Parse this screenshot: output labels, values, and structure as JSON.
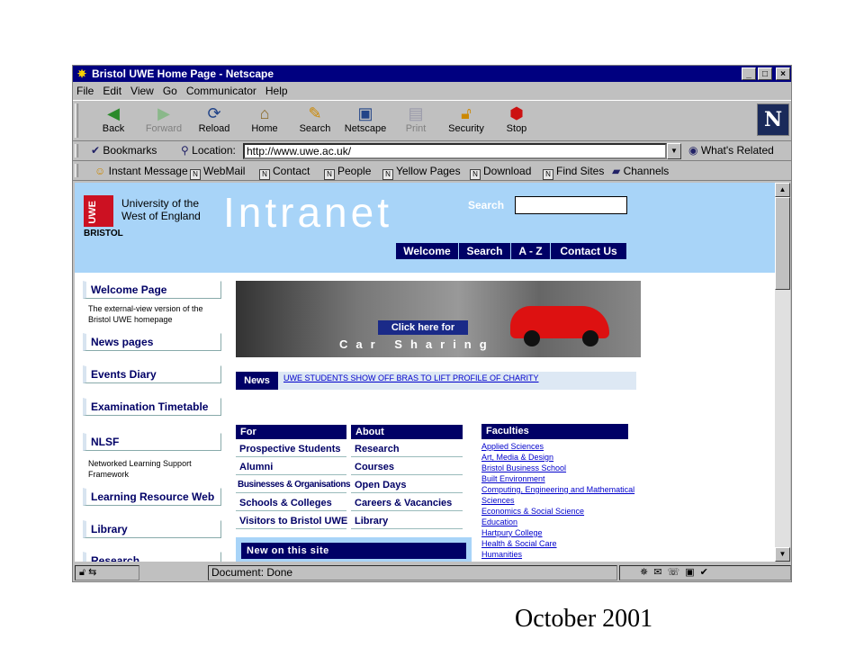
{
  "window": {
    "title": "Bristol UWE Home Page - Netscape",
    "controls": [
      "_",
      "□",
      "×"
    ]
  },
  "menu": [
    "File",
    "Edit",
    "View",
    "Go",
    "Communicator",
    "Help"
  ],
  "toolbar": {
    "buttons": [
      {
        "label": "Back",
        "icon": "back-arrow"
      },
      {
        "label": "Forward",
        "icon": "forward-arrow"
      },
      {
        "label": "Reload",
        "icon": "reload"
      },
      {
        "label": "Home",
        "icon": "house"
      },
      {
        "label": "Search",
        "icon": "search"
      },
      {
        "label": "Netscape",
        "icon": "my-netscape"
      },
      {
        "label": "Print",
        "icon": "printer"
      },
      {
        "label": "Security",
        "icon": "padlock"
      },
      {
        "label": "Stop",
        "icon": "stop-light"
      }
    ],
    "logo": "N"
  },
  "location": {
    "bookmarks_label": "Bookmarks",
    "location_label": "Location:",
    "url": "http://www.uwe.ac.uk/",
    "whats_related": "What's Related"
  },
  "personal_toolbar": [
    "Instant Message",
    "WebMail",
    "Contact",
    "People",
    "Yellow Pages",
    "Download",
    "Find Sites",
    "Channels"
  ],
  "status": {
    "text": "Document: Done"
  },
  "page": {
    "logo_text": "UWE",
    "logo_sub": "BRISTOL",
    "university_line1": "University of the",
    "university_line2": "West of England",
    "heading": "Intranet",
    "search_label": "Search",
    "nav_tabs": [
      "Welcome",
      "Search",
      "A - Z",
      "Contact Us"
    ],
    "sidebar": [
      {
        "label": "Welcome Page",
        "desc": "The external-view version of the Bristol UWE homepage"
      },
      {
        "label": "News pages",
        "desc": ""
      },
      {
        "label": "Events Diary",
        "desc": ""
      },
      {
        "label": "Examination Timetable",
        "desc": ""
      },
      {
        "label": "NLSF",
        "desc": "Networked Learning Support Framework"
      },
      {
        "label": "Learning Resource Web",
        "desc": ""
      },
      {
        "label": "Library",
        "desc": ""
      },
      {
        "label": "Research",
        "desc": ""
      }
    ],
    "car_sharing": {
      "click": "Click here for",
      "text": "Car Sharing"
    },
    "news": {
      "label": "News",
      "headline": "UWE STUDENTS SHOW OFF BRAS TO LIFT PROFILE OF CHARITY"
    },
    "for_column": {
      "heading": "For",
      "items": [
        "Prospective Students",
        "Alumni",
        "Businesses & Organisations",
        "Schools & Colleges",
        "Visitors to Bristol UWE"
      ]
    },
    "about_column": {
      "heading": "About",
      "items": [
        "Research",
        "Courses",
        "Open Days",
        "Careers & Vacancies",
        "Library"
      ]
    },
    "faculties": {
      "heading": "Faculties",
      "items": [
        "Applied Sciences",
        "Art, Media & Design",
        "Bristol Business School",
        "Built Environment",
        "Computing, Engineering and Mathematical",
        "Sciences",
        "Economics & Social Science",
        "Education",
        "Hartpury College",
        "Health & Social Care",
        "Humanities"
      ]
    },
    "new_on_site": "New on this site"
  },
  "caption": "October 2001"
}
